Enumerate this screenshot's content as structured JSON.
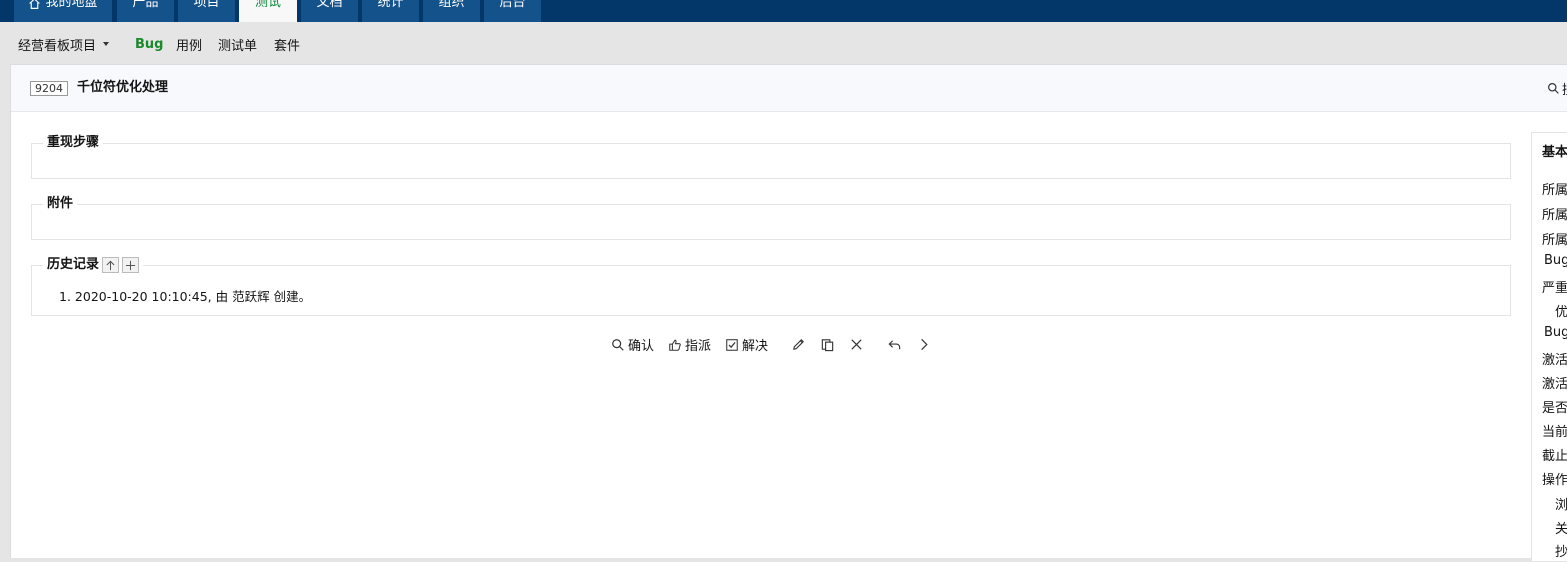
{
  "topnav": {
    "tabs": [
      {
        "label": "我的地盘",
        "icon": "home-icon"
      },
      {
        "label": "产品"
      },
      {
        "label": "项目"
      },
      {
        "label": "测试",
        "active": true
      },
      {
        "label": "文档"
      },
      {
        "label": "统计"
      },
      {
        "label": "组织"
      },
      {
        "label": "后台"
      }
    ]
  },
  "subnav": {
    "project": "经营看板项目",
    "items": [
      "Bug",
      "用例",
      "测试单",
      "套件"
    ]
  },
  "bug": {
    "id": "9204",
    "title": "千位符优化处理"
  },
  "header": {
    "search_label": "搜"
  },
  "sections": {
    "steps": "重现步骤",
    "attachments": "附件",
    "history": "历史记录"
  },
  "history": {
    "entries": [
      {
        "index": "1.",
        "text_before": "2020-10-20 10:10:45, 由 ",
        "user": "范跃辉",
        "text_after": " 创建。"
      }
    ]
  },
  "actions": {
    "confirm": "确认",
    "assign": "指派",
    "resolve": "解决"
  },
  "side": {
    "title": "基本",
    "rows": [
      "所属",
      "所属",
      "所属",
      "Bug",
      "严重",
      "优",
      "Bug",
      "激活",
      "激活",
      "是否",
      "当前",
      "截止",
      "操作",
      "浏",
      "关",
      "抄"
    ]
  },
  "colors": {
    "nav_bg": "#033769",
    "tab_bg": "#14528b",
    "active_tab_text": "#0e8a3a",
    "active_subnav": "#1b8a2c"
  }
}
